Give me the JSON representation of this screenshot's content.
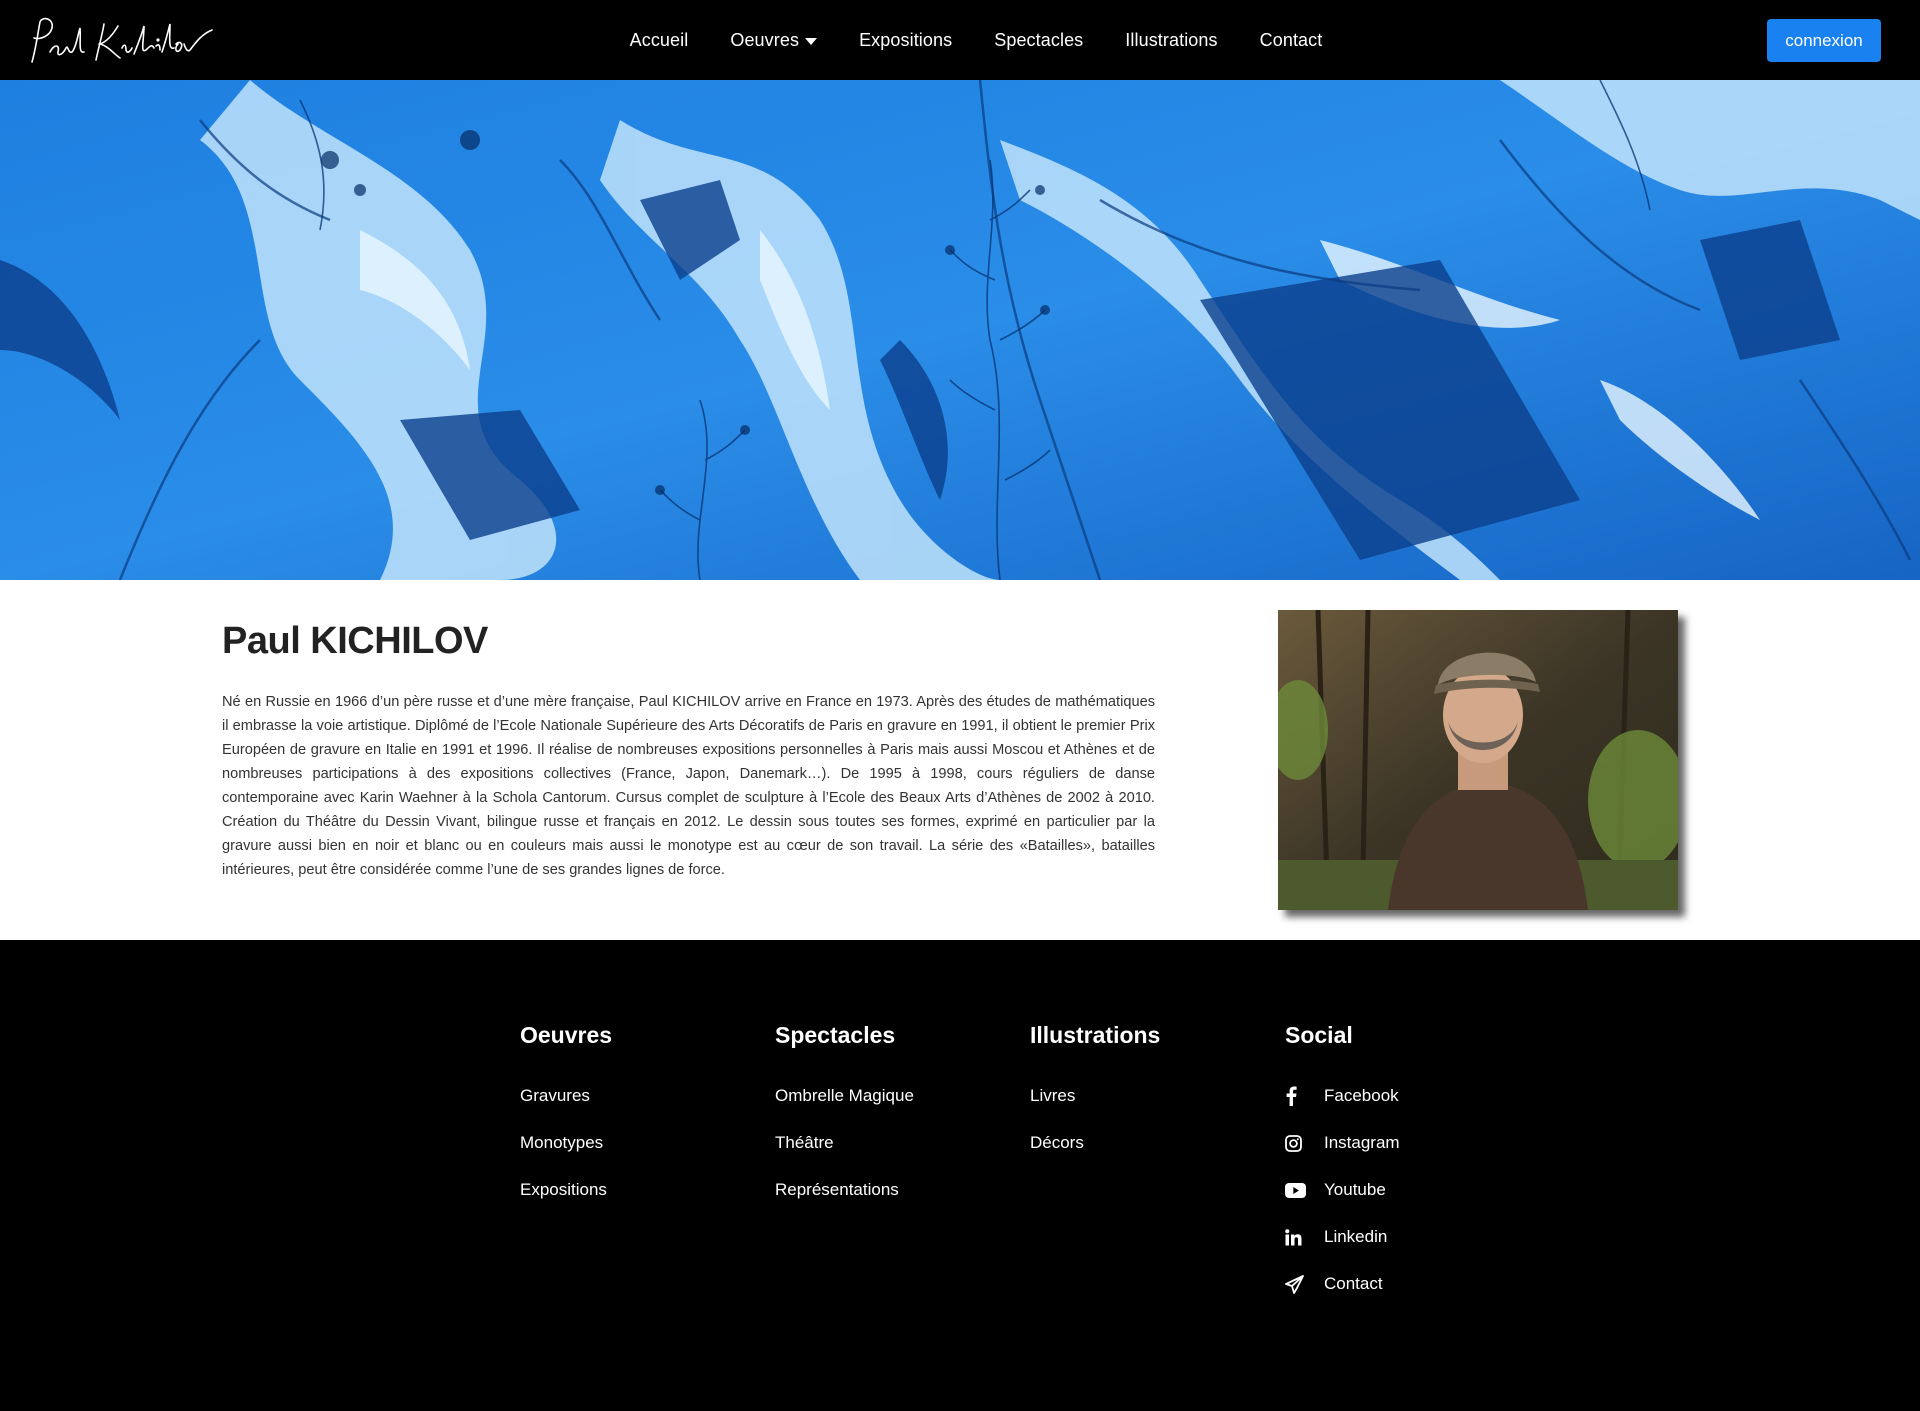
{
  "header": {
    "logo_text": "Paul Kichilov",
    "nav": [
      {
        "label": "Accueil"
      },
      {
        "label": "Oeuvres",
        "has_dropdown": true
      },
      {
        "label": "Expositions"
      },
      {
        "label": "Spectacles"
      },
      {
        "label": "Illustrations"
      },
      {
        "label": "Contact"
      }
    ],
    "login_label": "connexion"
  },
  "about": {
    "title": "Paul KICHILOV",
    "bio": "Né en Russie en 1966 d’un père russe et d’une mère française, Paul KICHILOV arrive en France en 1973. Après des études de mathématiques il embrasse la voie artistique. Diplômé de l’Ecole Nationale Supérieure des Arts Décoratifs de Paris en gravure en 1991, il obtient le premier Prix Européen de gravure en Italie en 1991 et 1996. Il réalise de nombreuses expositions personnelles à Paris mais aussi Moscou et Athènes et de nombreuses participations à des expositions collectives (France, Japon, Danemark…). De 1995 à 1998, cours réguliers de danse contemporaine avec Karin Waehner à la Schola Cantorum. Cursus complet de sculpture à l’Ecole des Beaux Arts d’Athènes de 2002 à 2010. Création du Théâtre du Dessin Vivant, bilingue russe et français en 2012. Le dessin sous toutes ses formes, exprimé en particulier par la gravure aussi bien en noir et blanc ou en couleurs mais aussi le monotype est au cœur de son travail. La série des «Batailles», batailles intérieures, peut être considérée comme l’une de ses grandes lignes de force."
  },
  "footer": {
    "columns": [
      {
        "heading": "Oeuvres",
        "links": [
          "Gravures",
          "Monotypes",
          "Expositions"
        ]
      },
      {
        "heading": "Spectacles",
        "links": [
          "Ombrelle Magique",
          "Théâtre",
          "Représentations"
        ]
      },
      {
        "heading": "Illustrations",
        "links": [
          "Livres",
          "Décors"
        ]
      }
    ],
    "social": {
      "heading": "Social",
      "links": [
        {
          "label": "Facebook",
          "icon": "facebook-icon"
        },
        {
          "label": "Instagram",
          "icon": "instagram-icon"
        },
        {
          "label": "Youtube",
          "icon": "youtube-icon"
        },
        {
          "label": "Linkedin",
          "icon": "linkedin-icon"
        },
        {
          "label": "Contact",
          "icon": "paper-plane-icon"
        }
      ]
    }
  },
  "colors": {
    "accent": "#1a82f0",
    "background_dark": "#000000",
    "hero_blue": "#1a74d4"
  }
}
